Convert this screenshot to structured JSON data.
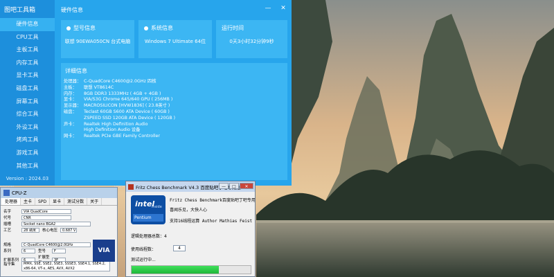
{
  "colors": {
    "toolbox_bg": "#27a5ec",
    "toolbox_sidebar": "#1d8fdc",
    "card_bg": "#3cb6f3",
    "progress_green": "#2ccf48"
  },
  "toolbox": {
    "app_name": "图吧工具箱",
    "version": "Version : 2024.03",
    "window_title": "硬件信息",
    "controls": {
      "minimize": "—",
      "close": "✕"
    },
    "nav": [
      {
        "label": "硬件信息",
        "active": true
      },
      {
        "label": "CPU工具"
      },
      {
        "label": "主板工具"
      },
      {
        "label": "内存工具"
      },
      {
        "label": "显卡工具"
      },
      {
        "label": "磁盘工具"
      },
      {
        "label": "屏幕工具"
      },
      {
        "label": "综合工具"
      },
      {
        "label": "外设工具"
      },
      {
        "label": "烤鸡工具"
      },
      {
        "label": "游戏工具"
      },
      {
        "label": "其他工具"
      }
    ],
    "cards": [
      {
        "title": "型号信息",
        "icon": "model-icon",
        "value": "联想 90EWA050CN 台式电脑"
      },
      {
        "title": "系统信息",
        "icon": "system-icon",
        "value": "Windows 7 Ultimate 64位"
      },
      {
        "title": "运行时间",
        "icon": "clock-icon",
        "value": "0天3小时32分钟9秒"
      }
    ],
    "detail": {
      "title": "详细信息",
      "rows": [
        {
          "key": "处理器：",
          "value": "C-QuadCore C4600@2.0GHz 四核"
        },
        {
          "key": "主板：",
          "value": "联想 VT8614C"
        },
        {
          "key": "内存：",
          "value": "8GB DDR3 1333MHz ( 4GB + 4GB )"
        },
        {
          "key": "显卡：",
          "value": "VIA/S3G Chrome 645/640 GPU ( 256MB )"
        },
        {
          "key": "显示器：",
          "value": "MACROSILICON [HVW1836] ( 23.8英寸 )"
        },
        {
          "key": "磁盘：",
          "value": "Teclast 60GB S600 ATA Device ( 60GB )"
        },
        {
          "key": "",
          "value": "ZSPEED SSD 120GB ATA Device ( 120GB )"
        },
        {
          "key": "声卡：",
          "value": "Realtek High Definition Audio"
        },
        {
          "key": "",
          "value": "High Definition Audio 设备"
        },
        {
          "key": "网卡：",
          "value": "Realtek PCIe GBE Family Controller"
        }
      ]
    }
  },
  "taskbar_hint": {
    "left": "explorer",
    "right": "CPU-Z"
  },
  "cpuz": {
    "title": "CPU-Z",
    "tabs": [
      "处理器",
      "主卡",
      "SPD",
      "显卡",
      "测试分数",
      "关于"
    ],
    "fields": {
      "name_label": "名字",
      "name": "VIA QuadCore",
      "codename_label": "代号",
      "codename": "CNR",
      "package_label": "插槽",
      "package": "Socket nano BGA2",
      "tech_label": "工艺",
      "tech": "28 纳米",
      "voltage_label": "核心电压",
      "voltage": "0.687 V",
      "spec_label": "规格",
      "spec": "C-QuadCore C4600@2.0GHz",
      "family_label": "系列",
      "family": "6",
      "model_label": "型号",
      "model": "F",
      "ext_family_label": "扩展系列",
      "ext_family": "6",
      "ext_model_label": "扩展型号",
      "ext_model": "3F",
      "inst_label": "指令集",
      "inst": "MMX, SSE, SSE2, SSE3, SSSE3, SSE4.1, SSE4.2, x86-64, VT-x, AES, AVX, AVX2"
    },
    "logo_text": "VIA"
  },
  "fritz": {
    "title": "Fritz Chess Benchmark V4.3  百度贴吧丁吧专用版",
    "controls": {
      "minimize": "—",
      "maximize": "□",
      "close": "✕"
    },
    "logo": {
      "brand": "intel",
      "inside": "inside",
      "product": "Pentium"
    },
    "text_lines": [
      "Fritz Chess Benchmark百度贴吧丁吧专用版",
      "喜闻乐见，大快人心",
      "支持16线程运算   Author Mathias Feist"
    ],
    "logical_label": "逻辑处理器总数：",
    "logical_value": "4",
    "threads_label": "使用线程数：",
    "threads_value": "4",
    "running_label": "测试运行中...",
    "progress": 0.73
  }
}
